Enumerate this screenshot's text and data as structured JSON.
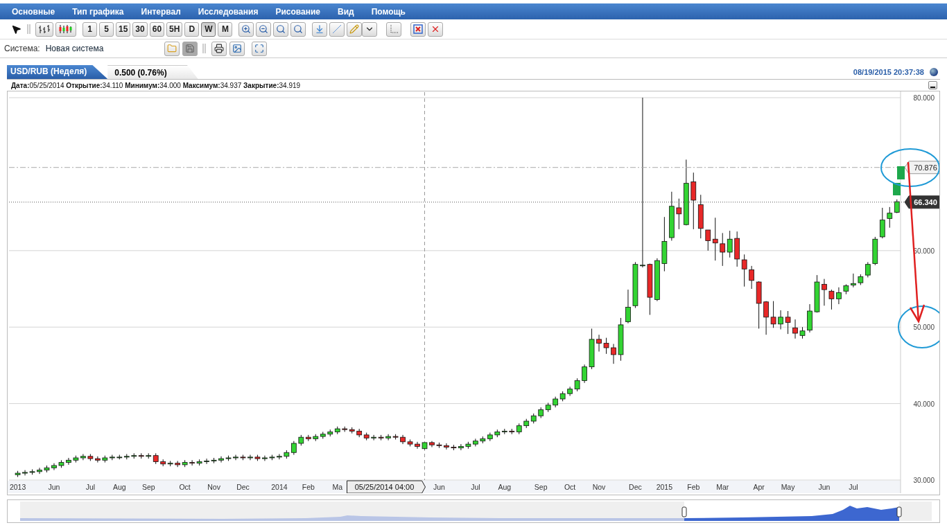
{
  "menu": [
    "Основные",
    "Тип графика",
    "Интервал",
    "Исследования",
    "Рисование",
    "Вид",
    "Помощь"
  ],
  "intervals": [
    {
      "label": "1",
      "selected": false
    },
    {
      "label": "5",
      "selected": false
    },
    {
      "label": "15",
      "selected": false
    },
    {
      "label": "30",
      "selected": false
    },
    {
      "label": "60",
      "selected": false
    },
    {
      "label": "5H",
      "selected": false
    },
    {
      "label": "D",
      "selected": false
    },
    {
      "label": "W",
      "selected": true
    },
    {
      "label": "M",
      "selected": false
    }
  ],
  "system": {
    "label": "Система:",
    "value": "Новая система"
  },
  "chart": {
    "tab_title": "USD/RUB (Неделя)",
    "change": "0.500 (0.76%)",
    "timestamp": "08/19/2015 20:37:38",
    "info": "**Дата:**05/25/2014 **Открытие:**34.110 **Минимум:**34.000 **Максимум:**34.937 **Закрытие:**34.919",
    "crosshair_label": "05/25/2014 04:00",
    "chart_data": {
      "type": "candlestick",
      "grid": true,
      "ylim": [
        30,
        80
      ],
      "yticks": [
        {
          "value": 30,
          "label": "30.000"
        },
        {
          "value": 40,
          "label": "40.000"
        },
        {
          "value": 50,
          "label": "50.000"
        },
        {
          "value": 60,
          "label": "60.000"
        },
        {
          "value": 80,
          "label": "80.000"
        }
      ],
      "categories": [
        "2013",
        null,
        null,
        null,
        null,
        "Jun",
        null,
        null,
        null,
        null,
        "Jul",
        null,
        null,
        null,
        "Aug",
        null,
        null,
        null,
        "Sep",
        null,
        null,
        null,
        null,
        "Oct",
        null,
        null,
        null,
        "Nov",
        null,
        null,
        null,
        "Dec",
        null,
        null,
        null,
        null,
        "2014",
        null,
        null,
        null,
        "Feb",
        null,
        null,
        null,
        "Ma",
        null,
        null,
        null,
        null,
        null,
        null,
        null,
        null,
        null,
        null,
        null,
        null,
        null,
        "Jun",
        null,
        null,
        null,
        null,
        "Jul",
        null,
        null,
        null,
        "Aug",
        null,
        null,
        null,
        null,
        "Sep",
        null,
        null,
        null,
        "Oct",
        null,
        null,
        null,
        "Nov",
        null,
        null,
        null,
        null,
        "Dec",
        null,
        null,
        null,
        "2015",
        null,
        null,
        null,
        "Feb",
        null,
        null,
        null,
        "Mar",
        null,
        null,
        null,
        null,
        "Apr",
        null,
        null,
        null,
        "May",
        null,
        null,
        null,
        null,
        "Jun",
        null,
        null,
        null,
        "Jul",
        null,
        null,
        null,
        null,
        null,
        null
      ],
      "ohlc": [
        [
          30.7,
          31.2,
          30.4,
          30.9
        ],
        [
          30.9,
          31.3,
          30.6,
          31.0
        ],
        [
          31.0,
          31.4,
          30.7,
          31.1
        ],
        [
          31.1,
          31.6,
          30.8,
          31.3
        ],
        [
          31.3,
          31.9,
          31.0,
          31.6
        ],
        [
          31.6,
          32.2,
          31.3,
          31.9
        ],
        [
          31.9,
          32.6,
          31.6,
          32.3
        ],
        [
          32.3,
          32.9,
          32.0,
          32.6
        ],
        [
          32.6,
          33.2,
          32.3,
          32.9
        ],
        [
          32.9,
          33.4,
          32.6,
          33.1
        ],
        [
          33.1,
          33.4,
          32.5,
          32.8
        ],
        [
          32.8,
          33.1,
          32.3,
          32.6
        ],
        [
          32.6,
          33.2,
          32.3,
          32.9
        ],
        [
          32.9,
          33.3,
          32.6,
          33.0
        ],
        [
          33.0,
          33.3,
          32.7,
          33.0
        ],
        [
          33.0,
          33.4,
          32.7,
          33.1
        ],
        [
          33.1,
          33.5,
          32.8,
          33.2
        ],
        [
          33.2,
          33.5,
          32.8,
          33.1
        ],
        [
          33.1,
          33.5,
          32.8,
          33.2
        ],
        [
          33.2,
          33.5,
          32.1,
          32.4
        ],
        [
          32.4,
          32.7,
          31.8,
          32.1
        ],
        [
          32.1,
          32.5,
          31.8,
          32.2
        ],
        [
          32.2,
          32.5,
          31.7,
          32.0
        ],
        [
          32.0,
          32.6,
          31.7,
          32.3
        ],
        [
          32.3,
          32.6,
          31.9,
          32.2
        ],
        [
          32.2,
          32.7,
          31.9,
          32.4
        ],
        [
          32.4,
          32.8,
          32.1,
          32.5
        ],
        [
          32.5,
          32.9,
          32.2,
          32.6
        ],
        [
          32.6,
          33.1,
          32.3,
          32.8
        ],
        [
          32.8,
          33.2,
          32.5,
          32.9
        ],
        [
          32.9,
          33.3,
          32.6,
          33.0
        ],
        [
          33.0,
          33.3,
          32.6,
          32.9
        ],
        [
          32.9,
          33.3,
          32.6,
          33.0
        ],
        [
          33.0,
          33.3,
          32.5,
          32.8
        ],
        [
          32.8,
          33.2,
          32.5,
          32.9
        ],
        [
          32.9,
          33.3,
          32.6,
          33.0
        ],
        [
          33.0,
          33.4,
          32.7,
          33.1
        ],
        [
          33.1,
          33.9,
          32.8,
          33.6
        ],
        [
          33.6,
          35.1,
          33.3,
          34.8
        ],
        [
          34.8,
          35.9,
          34.5,
          35.6
        ],
        [
          35.6,
          35.9,
          35.1,
          35.4
        ],
        [
          35.4,
          36.0,
          35.1,
          35.7
        ],
        [
          35.7,
          36.3,
          35.4,
          36.0
        ],
        [
          36.0,
          36.6,
          35.7,
          36.3
        ],
        [
          36.3,
          37.0,
          36.0,
          36.7
        ],
        [
          36.7,
          37.0,
          36.3,
          36.6
        ],
        [
          36.6,
          36.9,
          36.1,
          36.4
        ],
        [
          36.4,
          36.7,
          35.6,
          35.9
        ],
        [
          35.9,
          36.2,
          35.2,
          35.5
        ],
        [
          35.5,
          35.9,
          35.2,
          35.6
        ],
        [
          35.6,
          35.9,
          35.2,
          35.5
        ],
        [
          35.5,
          36.0,
          35.2,
          35.7
        ],
        [
          35.7,
          36.0,
          35.3,
          35.6
        ],
        [
          35.6,
          35.9,
          34.7,
          35.0
        ],
        [
          35.0,
          35.3,
          34.4,
          34.7
        ],
        [
          34.7,
          35.0,
          34.1,
          34.4
        ],
        [
          34.1,
          34.9,
          34.0,
          34.9
        ],
        [
          34.9,
          35.1,
          34.3,
          34.6
        ],
        [
          34.6,
          34.9,
          34.2,
          34.5
        ],
        [
          34.5,
          34.8,
          34.0,
          34.3
        ],
        [
          34.3,
          34.6,
          33.9,
          34.2
        ],
        [
          34.2,
          34.7,
          33.9,
          34.4
        ],
        [
          34.4,
          35.0,
          34.1,
          34.7
        ],
        [
          34.7,
          35.4,
          34.4,
          35.1
        ],
        [
          35.1,
          35.7,
          34.8,
          35.4
        ],
        [
          35.4,
          36.2,
          35.1,
          35.9
        ],
        [
          35.9,
          36.6,
          35.6,
          36.3
        ],
        [
          36.3,
          36.7,
          36.0,
          36.4
        ],
        [
          36.4,
          36.7,
          36.0,
          36.3
        ],
        [
          36.3,
          37.4,
          36.0,
          37.1
        ],
        [
          37.1,
          38.0,
          36.8,
          37.7
        ],
        [
          37.7,
          38.7,
          37.4,
          38.4
        ],
        [
          38.4,
          39.5,
          38.1,
          39.2
        ],
        [
          39.2,
          40.1,
          38.9,
          39.8
        ],
        [
          39.8,
          40.9,
          39.5,
          40.6
        ],
        [
          40.6,
          41.6,
          40.3,
          41.3
        ],
        [
          41.3,
          42.2,
          41.0,
          41.9
        ],
        [
          41.9,
          43.3,
          41.6,
          43.0
        ],
        [
          43.0,
          45.1,
          42.7,
          44.8
        ],
        [
          44.8,
          49.8,
          44.5,
          48.4
        ],
        [
          48.4,
          49.0,
          46.8,
          47.9
        ],
        [
          47.9,
          48.6,
          46.5,
          47.3
        ],
        [
          47.3,
          47.8,
          45.2,
          46.4
        ],
        [
          46.4,
          51.2,
          45.6,
          50.3
        ],
        [
          50.7,
          54.9,
          50.5,
          52.6
        ],
        [
          52.8,
          58.5,
          52.5,
          58.2
        ],
        [
          58.1,
          80.0,
          57.8,
          58.1
        ],
        [
          58.2,
          58.3,
          51.6,
          53.9
        ],
        [
          53.6,
          59.0,
          53.4,
          58.7
        ],
        [
          58.3,
          64.4,
          57.3,
          61.2
        ],
        [
          61.7,
          67.7,
          61.3,
          65.8
        ],
        [
          65.6,
          66.8,
          62.8,
          64.8
        ],
        [
          63.4,
          71.9,
          63.3,
          68.8
        ],
        [
          69.0,
          70.2,
          62.8,
          66.6
        ],
        [
          66.0,
          67.3,
          61.6,
          62.9
        ],
        [
          62.7,
          62.7,
          60.0,
          61.3
        ],
        [
          61.5,
          64.3,
          58.7,
          61.0
        ],
        [
          60.9,
          62.3,
          58.0,
          59.8
        ],
        [
          59.8,
          62.6,
          59.1,
          61.5
        ],
        [
          61.6,
          62.5,
          57.9,
          58.9
        ],
        [
          58.8,
          59.5,
          55.3,
          57.6
        ],
        [
          57.5,
          58.0,
          55.0,
          56.1
        ],
        [
          55.9,
          56.0,
          49.8,
          53.1
        ],
        [
          53.3,
          53.4,
          49.0,
          51.3
        ],
        [
          51.3,
          53.4,
          49.9,
          50.4
        ],
        [
          50.4,
          52.2,
          49.7,
          51.3
        ],
        [
          51.3,
          52.1,
          49.1,
          50.6
        ],
        [
          49.9,
          51.0,
          48.5,
          49.2
        ],
        [
          48.9,
          50.0,
          48.5,
          49.5
        ],
        [
          49.6,
          53.0,
          49.3,
          52.1
        ],
        [
          52.0,
          56.8,
          51.9,
          55.9
        ],
        [
          55.6,
          56.3,
          52.8,
          54.9
        ],
        [
          54.7,
          54.9,
          52.3,
          53.7
        ],
        [
          53.7,
          55.2,
          53.0,
          54.5
        ],
        [
          54.7,
          55.6,
          54.3,
          55.4
        ],
        [
          55.5,
          57.0,
          55.2,
          55.7
        ],
        [
          55.8,
          56.9,
          55.5,
          56.6
        ],
        [
          56.8,
          58.5,
          56.5,
          58.2
        ],
        [
          58.3,
          61.8,
          58.1,
          61.5
        ],
        [
          61.8,
          65.6,
          61.6,
          64.0
        ],
        [
          64.2,
          65.7,
          63.0,
          64.9
        ],
        [
          65.0,
          66.7,
          64.9,
          66.4
        ]
      ],
      "ref_lines": [
        {
          "axis": "y",
          "value": 70.876,
          "label": "70.876"
        },
        {
          "axis": "y",
          "value": 66.34,
          "label": "66.340"
        }
      ]
    }
  }
}
